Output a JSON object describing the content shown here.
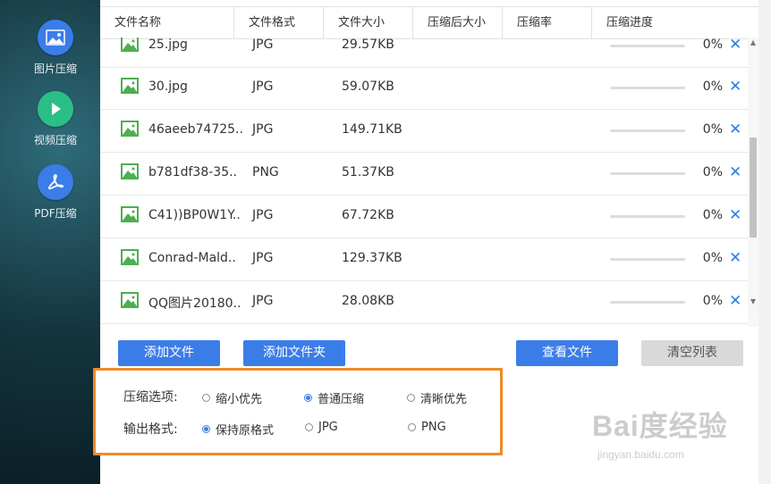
{
  "sidebar": {
    "items": [
      {
        "label": "图片压缩",
        "icon": "image-icon"
      },
      {
        "label": "视频压缩",
        "icon": "play-icon"
      },
      {
        "label": "PDF压缩",
        "icon": "pdf-icon"
      }
    ]
  },
  "table": {
    "headers": [
      "文件名称",
      "文件格式",
      "文件大小",
      "压缩后大小",
      "压缩率",
      "压缩进度"
    ],
    "rows": [
      {
        "name": "25.jpg",
        "format": "JPG",
        "size": "29.57KB",
        "progress": "0%"
      },
      {
        "name": "30.jpg",
        "format": "JPG",
        "size": "59.07KB",
        "progress": "0%"
      },
      {
        "name": "46aeeb74725..",
        "format": "JPG",
        "size": "149.71KB",
        "progress": "0%"
      },
      {
        "name": "b781df38-35..",
        "format": "PNG",
        "size": "51.37KB",
        "progress": "0%"
      },
      {
        "name": "C41))BP0W1Y..",
        "format": "JPG",
        "size": "67.72KB",
        "progress": "0%"
      },
      {
        "name": "Conrad-Mald..",
        "format": "JPG",
        "size": "129.37KB",
        "progress": "0%"
      },
      {
        "name": "QQ图片20180..",
        "format": "JPG",
        "size": "28.08KB",
        "progress": "0%"
      }
    ],
    "delete_glyph": "✕"
  },
  "actions": {
    "add_file": "添加文件",
    "add_folder": "添加文件夹",
    "view_files": "查看文件",
    "clear_list": "清空列表"
  },
  "options": {
    "compress_label": "压缩选项:",
    "compress_choices": [
      {
        "label": "缩小优先",
        "selected": false
      },
      {
        "label": "普通压缩",
        "selected": true
      },
      {
        "label": "清晰优先",
        "selected": false
      }
    ],
    "output_label": "输出格式:",
    "output_choices": [
      {
        "label": "保持原格式",
        "selected": true
      },
      {
        "label": "JPG",
        "selected": false
      },
      {
        "label": "PNG",
        "selected": false
      }
    ]
  },
  "watermark": {
    "main": "Bai度经验",
    "sub": "jingyan.baidu.com"
  },
  "colors": {
    "accent": "#3b7de8",
    "highlight_border": "#ef8a28",
    "icon_green": "#4caf50"
  }
}
